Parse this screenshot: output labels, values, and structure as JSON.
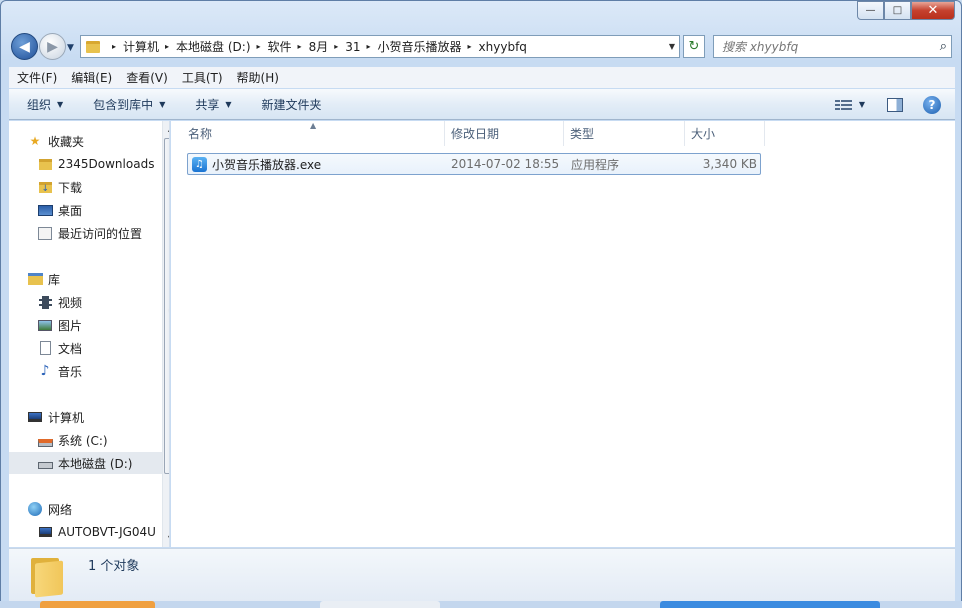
{
  "window": {
    "title_controls": {
      "minimize": "—",
      "maximize": "□",
      "close": "✕"
    }
  },
  "nav": {
    "back": "◀",
    "forward": "▶",
    "recent": "▼"
  },
  "address": {
    "breadcrumbs": [
      "计算机",
      "本地磁盘 (D:)",
      "软件",
      "8月",
      "31",
      "小贺音乐播放器",
      "xhyybfq"
    ],
    "separator": "▸",
    "dropdown": "▼",
    "refresh": "↻"
  },
  "search": {
    "placeholder": "搜索 xhyybfq",
    "icon": "search-icon"
  },
  "menu": {
    "items": [
      "文件(F)",
      "编辑(E)",
      "查看(V)",
      "工具(T)",
      "帮助(H)"
    ]
  },
  "commands": {
    "items": [
      {
        "label": "组织",
        "caret": "▼"
      },
      {
        "label": "包含到库中",
        "caret": "▼"
      },
      {
        "label": "共享",
        "caret": "▼"
      },
      {
        "label": "新建文件夹",
        "caret": ""
      }
    ],
    "view_caret": "▼",
    "help": "?"
  },
  "navpane": {
    "favorites_header": "收藏夹",
    "favorites": [
      "2345Downloads",
      "下载",
      "桌面",
      "最近访问的位置"
    ],
    "libraries_header": "库",
    "libraries": [
      "视频",
      "图片",
      "文档",
      "音乐"
    ],
    "computer_header": "计算机",
    "drives": [
      "系统 (C:)",
      "本地磁盘 (D:)"
    ],
    "network_header": "网络",
    "network": [
      "AUTOBVT-JG04U"
    ],
    "selected": "本地磁盘 (D:)"
  },
  "columns": {
    "name": "名称",
    "modified": "修改日期",
    "type": "类型",
    "size": "大小",
    "sort_indicator": "▲"
  },
  "files": [
    {
      "name": "小贺音乐播放器.exe",
      "modified": "2014-07-02 18:55",
      "type": "应用程序",
      "size": "3,340 KB",
      "icon": "music-note-icon"
    }
  ],
  "details": {
    "count_text": "1 个对象"
  },
  "colors": {
    "accent": "#1f4f98",
    "selection_border": "#7da2ce",
    "chrome": "#c7dbf2"
  }
}
